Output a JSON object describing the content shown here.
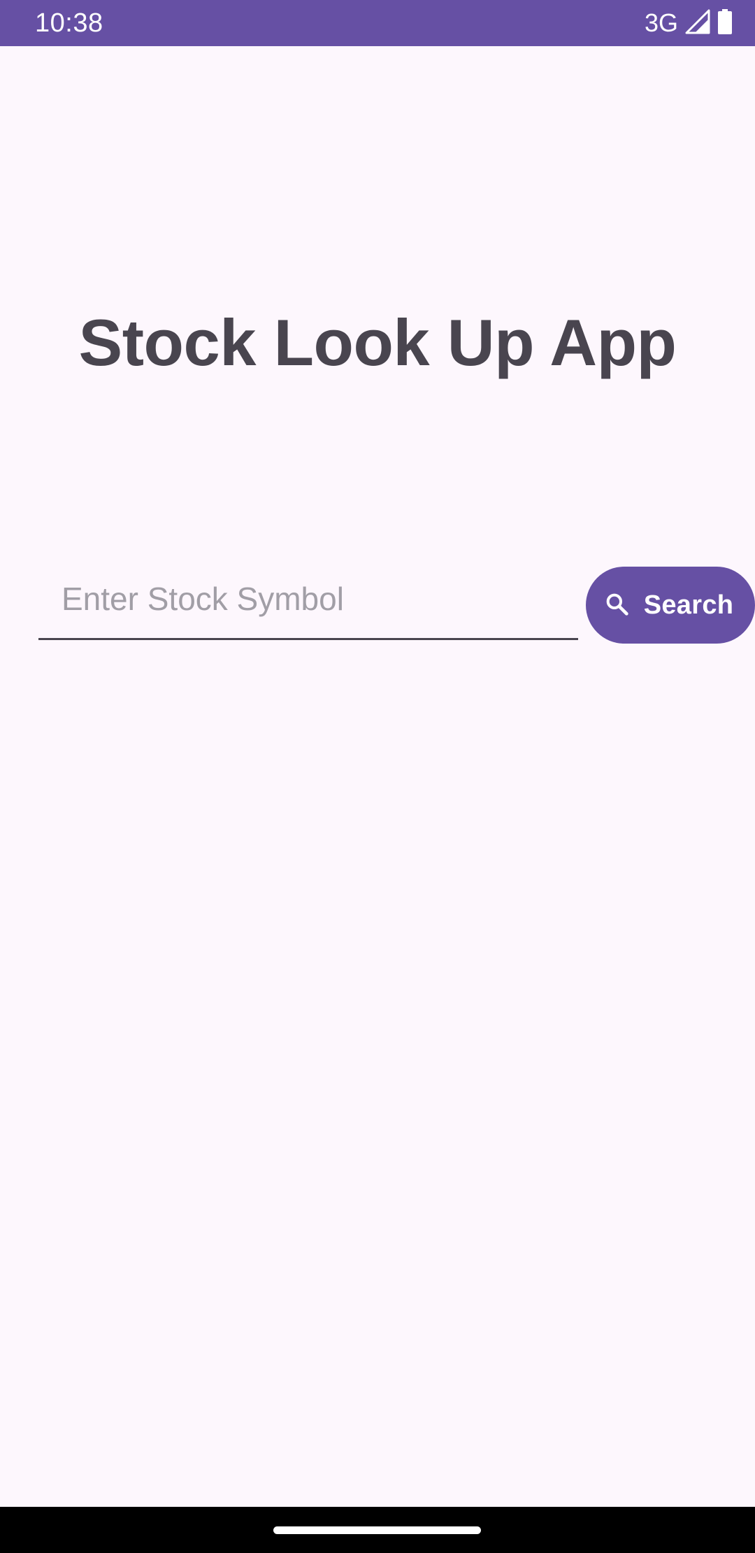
{
  "status_bar": {
    "time": "10:38",
    "network": "3G",
    "icons": [
      "signal-icon",
      "battery-icon"
    ]
  },
  "app": {
    "title": "Stock Look Up App"
  },
  "search": {
    "placeholder": "Enter Stock Symbol",
    "value": "",
    "button_label": "Search",
    "button_icon": "search-icon"
  },
  "colors": {
    "primary": "#6650a4",
    "background": "#fdf7fd",
    "title_text": "#49454f",
    "placeholder": "#a19ea6"
  }
}
